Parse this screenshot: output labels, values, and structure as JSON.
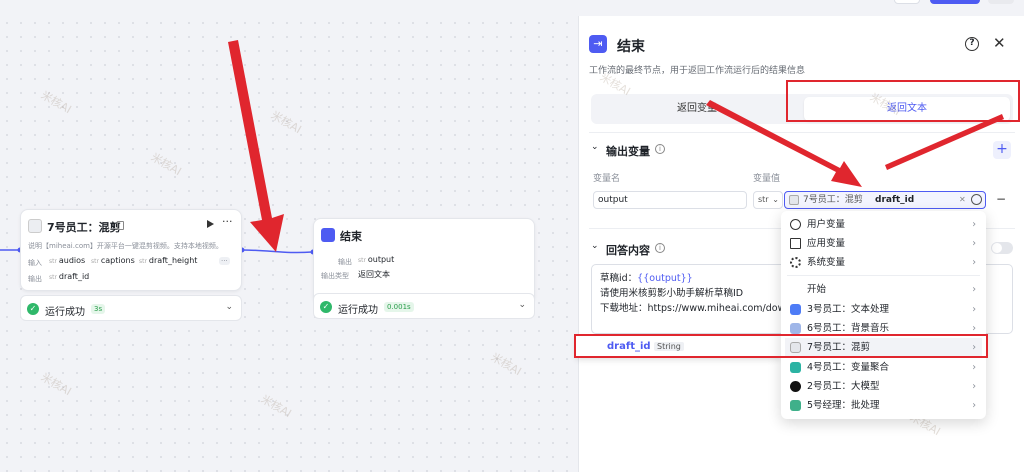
{
  "canvas": {
    "node_mix": {
      "title": "7号员工：混剪",
      "desc": "说明【miheai.com】开源平台一键混剪视频。支持本地视频。",
      "input_label": "输入",
      "inputs": [
        "audios",
        "captions",
        "draft_height"
      ],
      "output_label": "输出",
      "output": "draft_id",
      "status": "运行成功",
      "time": "3s"
    },
    "node_end": {
      "title": "结束",
      "output_label": "输出",
      "output": "output",
      "type_label": "输出类型",
      "type_value": "返回文本",
      "status": "运行成功",
      "time": "0.001s"
    }
  },
  "panel": {
    "title": "结束",
    "desc": "工作流的最终节点，用于返回工作流运行后的结果信息",
    "tabs": [
      "返回变量",
      "返回文本"
    ],
    "output_section": "输出变量",
    "col_name": "变量名",
    "col_value": "变量值",
    "var_name": "output",
    "var_type": "str",
    "var_ref_node": "7号员工：混剪",
    "var_ref_field": "draft_id",
    "answer_section": "回答内容",
    "answer_lines": [
      "草稿id：{{output}}",
      "请使用米核剪影小助手解析草稿ID",
      "下载地址：https://www.miheai.com/dow"
    ],
    "answer_var_prefix": "草稿id：",
    "answer_var": "{{output}}",
    "suggestion_name": "draft_id",
    "suggestion_type": "String"
  },
  "dropdown": {
    "items": [
      {
        "label": "用户变量",
        "icon": "user-icon"
      },
      {
        "label": "应用变量",
        "icon": "folder-icon"
      },
      {
        "label": "系统变量",
        "icon": "gear-icon"
      },
      {
        "label": "开始",
        "icon": "start-icon"
      },
      {
        "label": "3号员工：文本处理",
        "icon": "text-process-icon"
      },
      {
        "label": "6号员工：背景音乐",
        "icon": "music-icon"
      },
      {
        "label": "7号员工：混剪",
        "icon": "mix-icon"
      },
      {
        "label": "4号员工：变量聚合",
        "icon": "aggregate-icon"
      },
      {
        "label": "2号员工：大模型",
        "icon": "llm-icon"
      },
      {
        "label": "5号经理：批处理",
        "icon": "batch-icon"
      }
    ]
  },
  "watermark": "米核AI",
  "colors": {
    "accent": "#4e5bf2",
    "highlight": "#e0262e",
    "success": "#2fb86a"
  }
}
